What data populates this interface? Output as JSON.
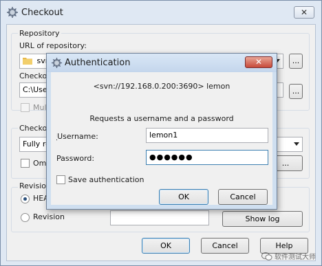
{
  "main_window": {
    "title": "Checkout",
    "close_symbol": "✕",
    "repository": {
      "group_label": "Repository",
      "url_label": "URL of repository:",
      "url_value": "svn",
      "browse_label": "..."
    },
    "checkout_dir": {
      "label": "Checkout",
      "value": "C:\\User",
      "browse_label": "...",
      "multi_label": "Multi"
    },
    "checkout_depth": {
      "group_label": "Checkout",
      "depth_value": "Fully re",
      "omit_label": "Omit",
      "more_button": "..."
    },
    "revision": {
      "group_label": "Revision",
      "head_label": "HEAD",
      "revision_label": "Revision",
      "revision_value": "",
      "show_log_label": "Show log"
    },
    "buttons": {
      "ok": "OK",
      "cancel": "Cancel",
      "help": "Help"
    }
  },
  "auth_dialog": {
    "title": "Authentication",
    "close_symbol": "✕",
    "realm": "<svn://192.168.0.200:3690> lemon",
    "message": "Requests a username and a password",
    "username_label": "Username:",
    "username_value": "lemon1",
    "password_label": "Password:",
    "password_value": "●●●●●●",
    "save_label": "Save authentication",
    "ok_label": "OK",
    "cancel_label": "Cancel"
  },
  "watermark": {
    "text": "软件测试大师"
  },
  "icons": {
    "app": "tortoise-svn-icon",
    "folder": "folder-icon",
    "watermark": "wechat-icon"
  }
}
